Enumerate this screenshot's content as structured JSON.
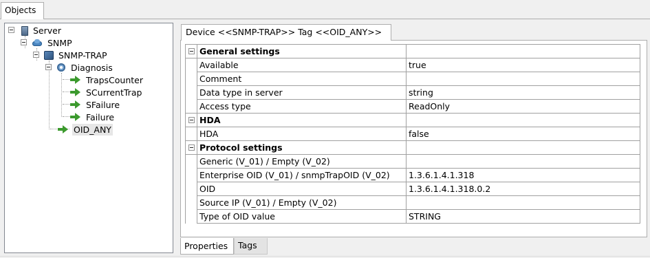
{
  "objects_tab": {
    "label": "Objects"
  },
  "tree": {
    "nodes": [
      {
        "label": "Server",
        "icon": "server-icon"
      },
      {
        "label": "SNMP",
        "icon": "snmp-cloud-icon"
      },
      {
        "label": "SNMP-TRAP",
        "icon": "device-icon"
      },
      {
        "label": "Diagnosis",
        "icon": "diagnosis-icon"
      },
      {
        "label": "TrapsCounter",
        "icon": "tag-arrow-icon"
      },
      {
        "label": "SCurrentTrap",
        "icon": "tag-arrow-icon"
      },
      {
        "label": "SFailure",
        "icon": "tag-arrow-icon"
      },
      {
        "label": "Failure",
        "icon": "tag-arrow-icon"
      },
      {
        "label": "OID_ANY",
        "icon": "tag-arrow-icon",
        "selected": true
      }
    ]
  },
  "device_tab": {
    "label": "Device <<SNMP-TRAP>> Tag <<OID_ANY>>"
  },
  "properties": {
    "categories": [
      {
        "name": "General settings",
        "rows": [
          {
            "name": "Available",
            "value": "true"
          },
          {
            "name": "Comment",
            "value": ""
          },
          {
            "name": "Data type in server",
            "value": "string"
          },
          {
            "name": "Access type",
            "value": "ReadOnly"
          }
        ]
      },
      {
        "name": "HDA",
        "rows": [
          {
            "name": "HDA",
            "value": "false"
          }
        ]
      },
      {
        "name": "Protocol settings",
        "rows": [
          {
            "name": "Generic (V_01) / Empty (V_02)",
            "value": ""
          },
          {
            "name": "Enterprise OID (V_01) / snmpTrapOID (V_02)",
            "value": "1.3.6.1.4.1.318"
          },
          {
            "name": "OID",
            "value": "1.3.6.1.4.1.318.0.2"
          },
          {
            "name": "Source IP (V_01) / Empty (V_02)",
            "value": ""
          },
          {
            "name": "Type of OID value",
            "value": "STRING"
          }
        ]
      }
    ]
  },
  "bottom_tabs": {
    "properties": "Properties",
    "tags": "Tags"
  }
}
